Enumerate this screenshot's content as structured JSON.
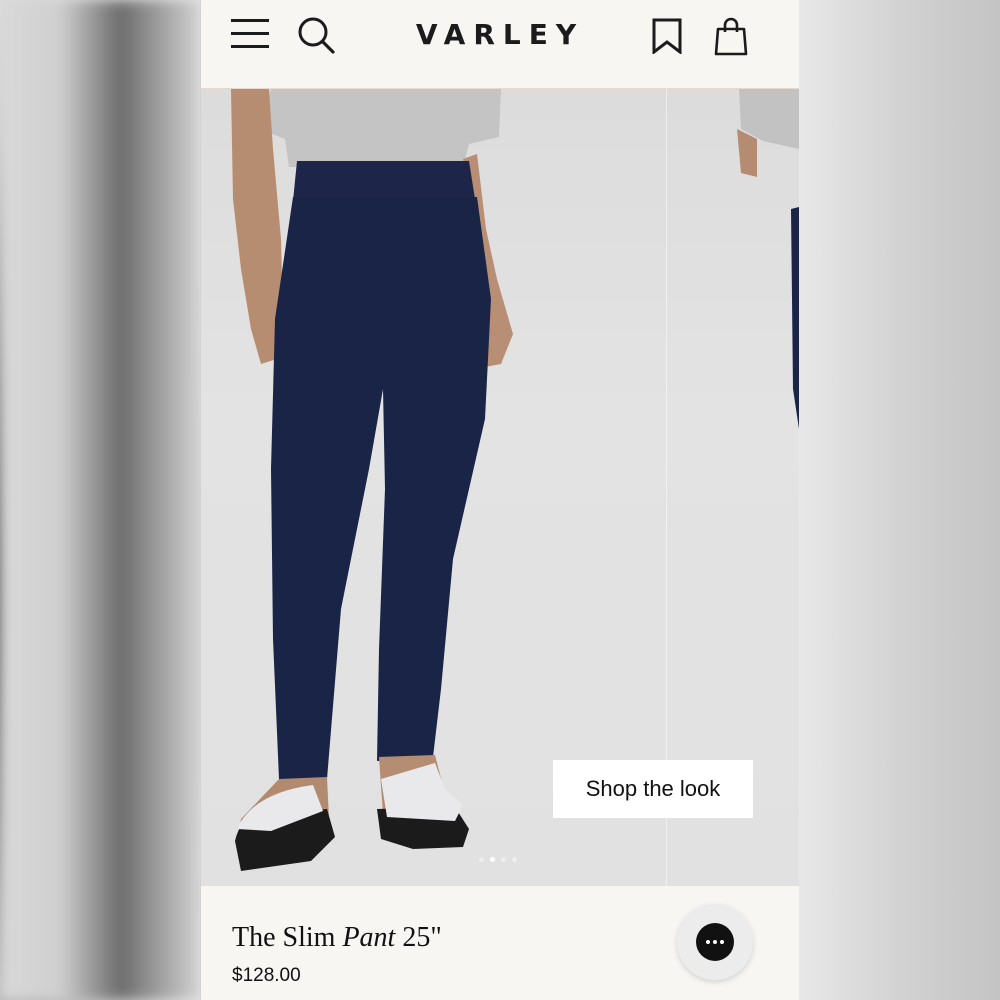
{
  "header": {
    "logo": "VARLEY",
    "icons": [
      "menu-icon",
      "search-icon",
      "bookmark-icon",
      "shopping-bag-icon"
    ]
  },
  "hero": {
    "shop_the_look_label": "Shop the look",
    "carousel": {
      "slide_count": 4,
      "active_index": 1
    }
  },
  "product": {
    "title_prefix": "The Slim",
    "title_italic": "Pant",
    "title_suffix": "25\"",
    "price": "$128.00"
  },
  "chat": {
    "icon": "chat-bubble-icon"
  },
  "colors": {
    "background": "#f7f6f3",
    "text": "#111111",
    "pant_navy": "#1a2447",
    "header_border": "#e4d8cf"
  }
}
